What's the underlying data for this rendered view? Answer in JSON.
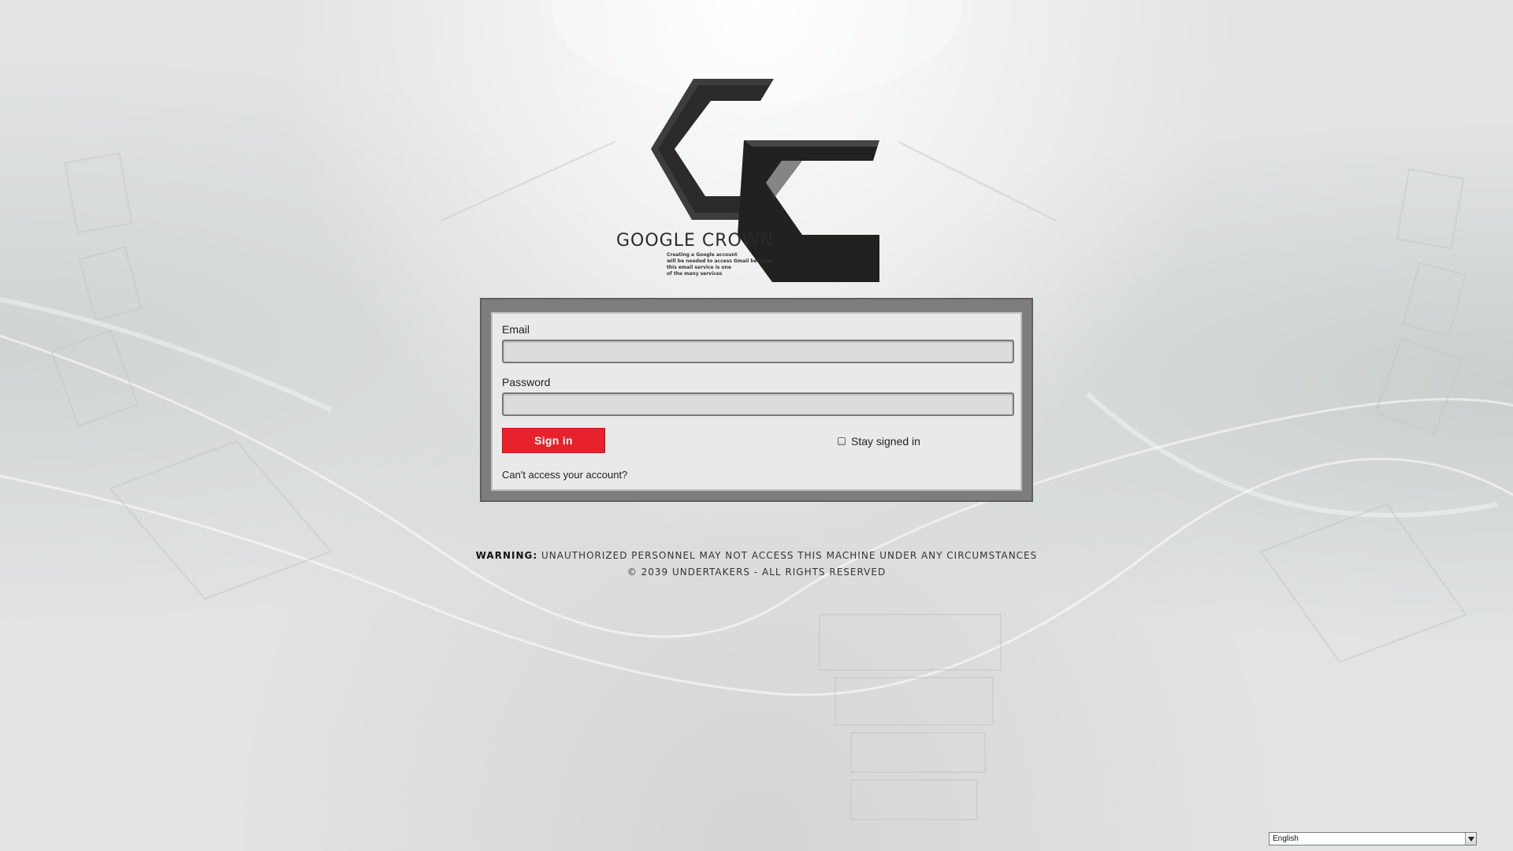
{
  "logo": {
    "title": "GOOGLE CROWN",
    "tagline": [
      "Creating a Google account",
      "will be needed to access Gmail because",
      "this email service is one",
      "of the many services"
    ]
  },
  "form": {
    "email_label": "Email",
    "email_value": "",
    "password_label": "Password",
    "password_value": "",
    "signin_label": "Sign in",
    "stay_signed_in_label": "Stay signed in",
    "stay_signed_in_checked": false,
    "cant_access_label": "Can't access your account?"
  },
  "footer": {
    "warning_prefix": "WARNING:",
    "warning_text": "UNAUTHORIZED PERSONNEL MAY NOT ACCESS THIS MACHINE UNDER ANY CIRCUMSTANCES",
    "copyright": "© 2039 UNDERTAKERS - ALL RIGHTS RESERVED"
  },
  "language": {
    "selected": "English"
  },
  "colors": {
    "accent": "#e8222c",
    "panel_frame": "#7d7d7d",
    "logo": "#2b2b2b"
  },
  "icons": {
    "language_dropdown": "chevron-down-icon",
    "logo": "gc-logo-icon"
  }
}
